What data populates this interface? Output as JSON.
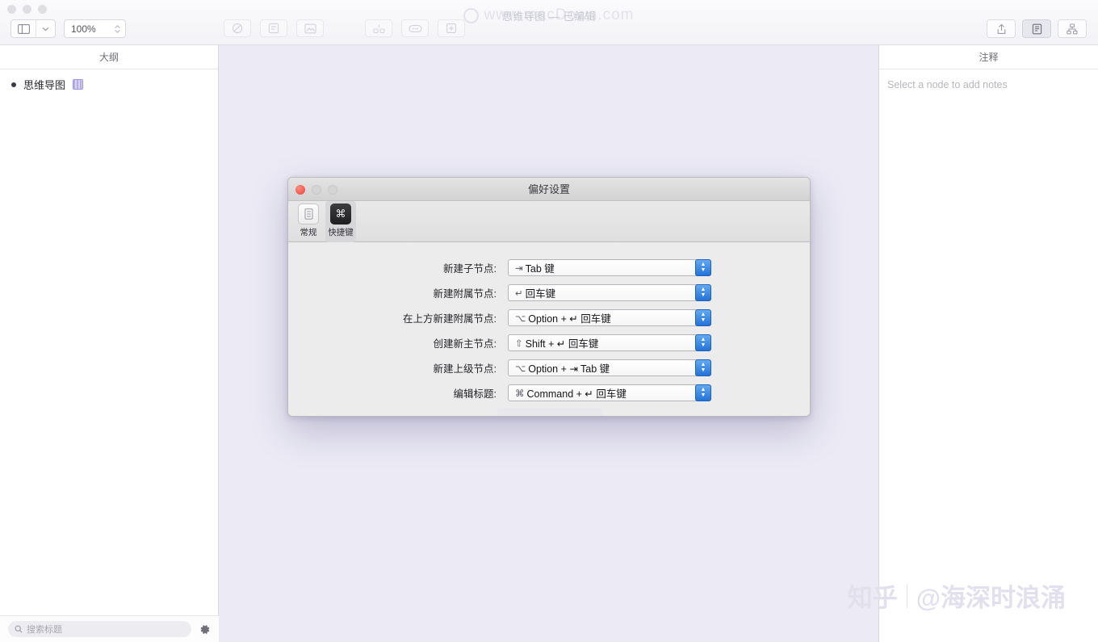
{
  "window": {
    "title": "思维导图 — 已编辑",
    "watermark_top": "www.macDown.com",
    "watermark_bottom_brand": "知乎",
    "watermark_bottom_user": "@海深时浪涌"
  },
  "toolbar": {
    "zoom_value": "100%",
    "sidebar_toggle_icon": "sidebar-icon",
    "sidebar_menu_icon": "chevron-down-icon",
    "zoom_stepper_icon": "stepper-icon",
    "buttons": [
      {
        "name": "no-style-button",
        "icon": "circle-slash-icon"
      },
      {
        "name": "sticker-button",
        "icon": "sticker-icon"
      },
      {
        "name": "image-button",
        "icon": "image-icon"
      },
      {
        "name": "layout-button",
        "icon": "layout-icon"
      },
      {
        "name": "relation-button",
        "icon": "relation-icon"
      },
      {
        "name": "add-node-button",
        "icon": "plus-box-icon"
      }
    ],
    "right_buttons": [
      {
        "name": "share-button",
        "icon": "share-icon",
        "selected": false
      },
      {
        "name": "notes-panel-button",
        "icon": "notes-icon",
        "selected": true
      },
      {
        "name": "mindmap-view-button",
        "icon": "mindmap-icon",
        "selected": false
      }
    ]
  },
  "sidebar": {
    "header": "大纲",
    "items": [
      {
        "label": "思维导图",
        "badge_icon": "node-badge-icon"
      }
    ],
    "search_placeholder": "搜索标题",
    "search_icon": "search-icon",
    "settings_icon": "gear-icon"
  },
  "notes_panel": {
    "header": "注释",
    "placeholder": "Select a node to add notes"
  },
  "preferences": {
    "title": "偏好设置",
    "tabs": [
      {
        "label": "常规",
        "icon": "general-icon",
        "active": false
      },
      {
        "label": "快捷键",
        "icon": "keyboard-shortcut-icon",
        "active": true
      }
    ],
    "rows": [
      {
        "label": "新建子节点:",
        "symbol": "⇥",
        "value": "Tab 键"
      },
      {
        "label": "新建附属节点:",
        "symbol": "↵",
        "value": "回车键"
      },
      {
        "label": "在上方新建附属节点:",
        "symbol": "⌥",
        "value": "Option + ↵ 回车键"
      },
      {
        "label": "创建新主节点:",
        "symbol": "⇧",
        "value": "Shift + ↵ 回车键"
      },
      {
        "label": "新建上级节点:",
        "symbol": "⌥",
        "value": "Option + ⇥ Tab 键"
      },
      {
        "label": "编辑标题:",
        "symbol": "⌘",
        "value": "Command + ↵ 回车键"
      }
    ]
  },
  "colors": {
    "canvas": "#ebeaf5",
    "accent": "#2472d6",
    "dialog_bg": "#ececec"
  }
}
